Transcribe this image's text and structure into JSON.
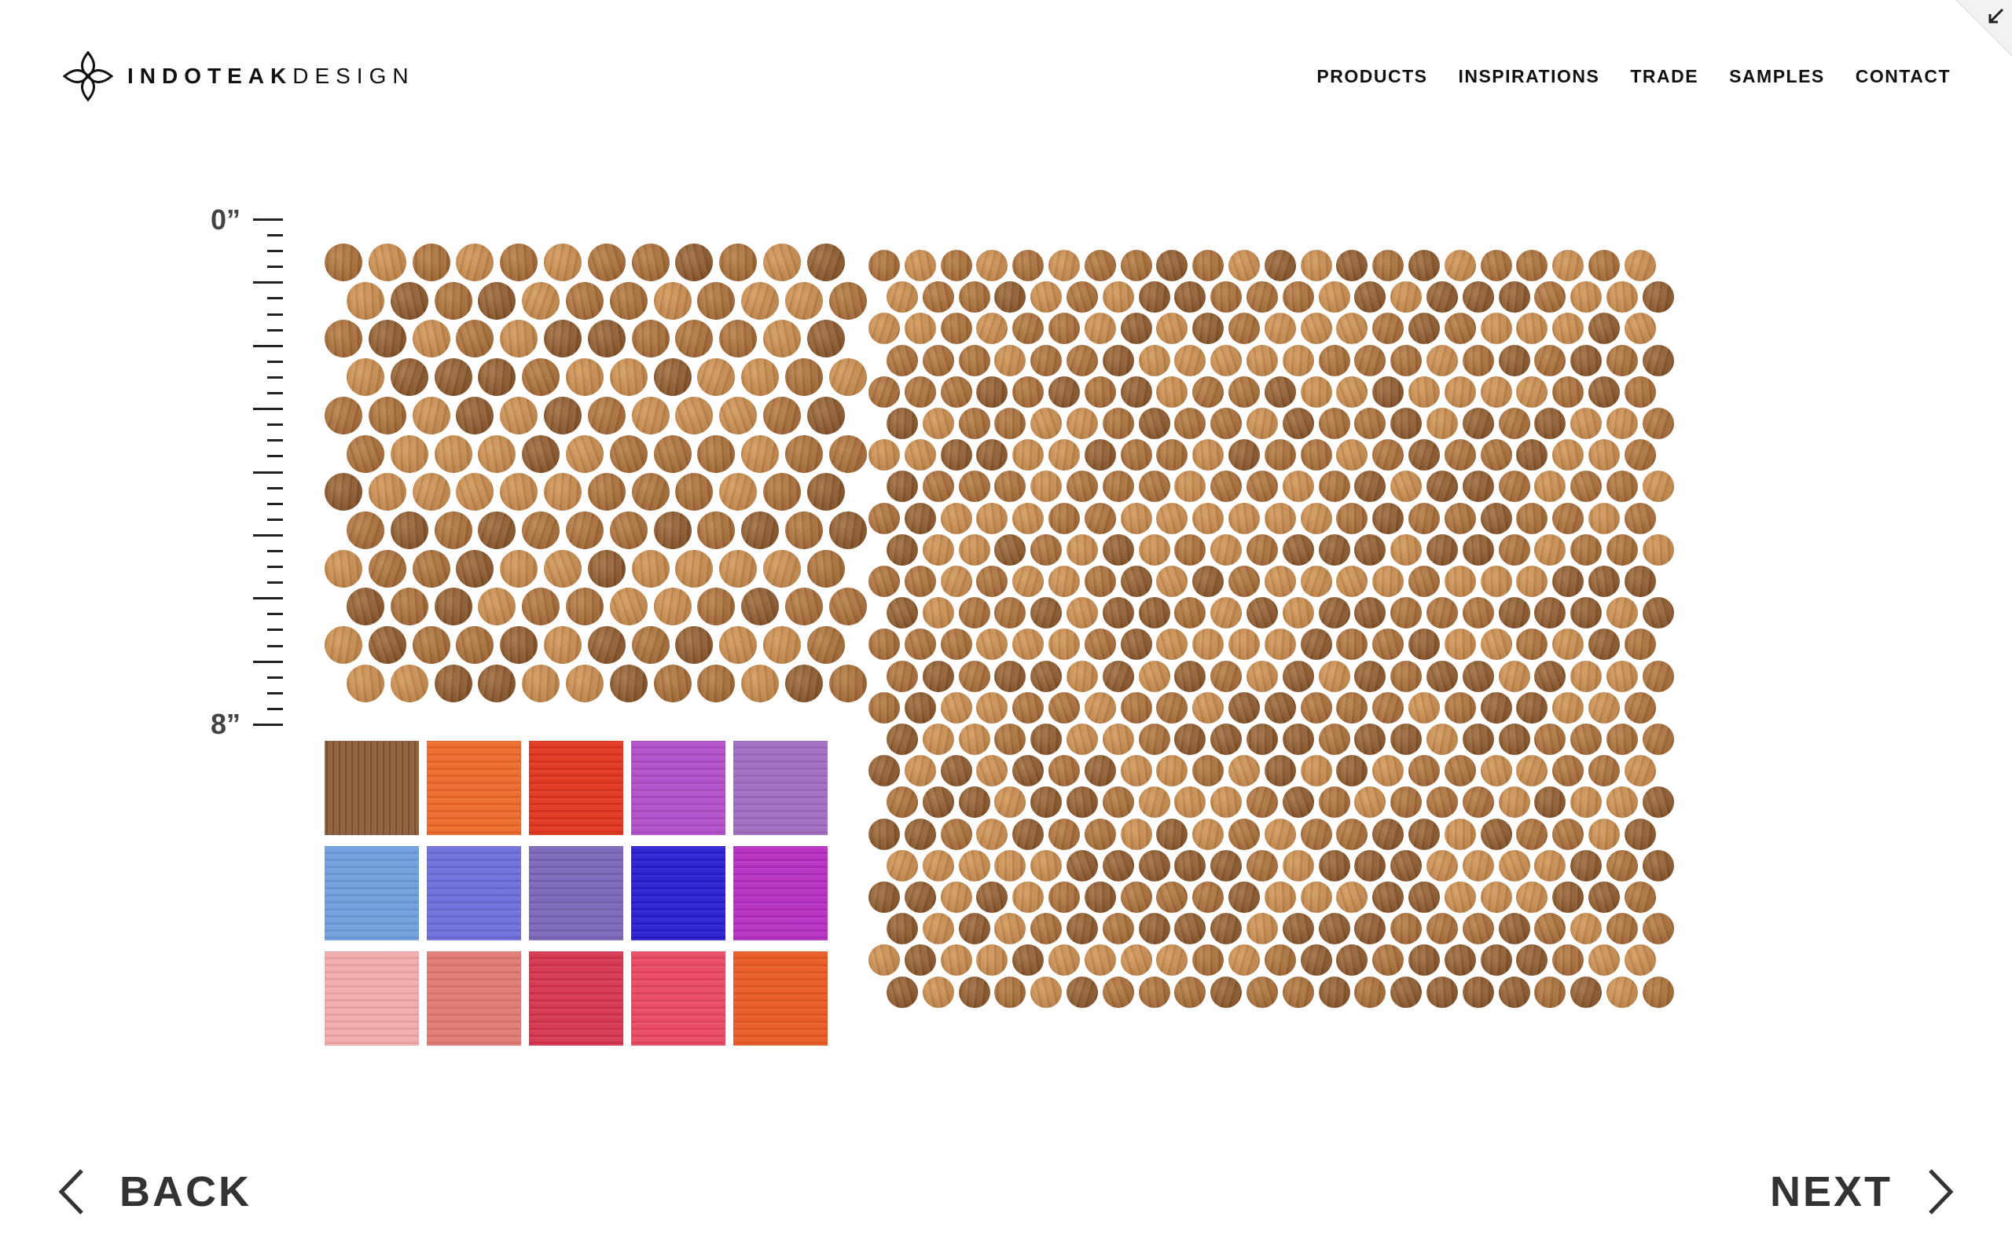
{
  "brand": {
    "name_strong": "INDOTEAK",
    "name_light": "DESIGN",
    "logo_icon": "four-petal-logo-icon"
  },
  "nav": {
    "items": [
      "PRODUCTS",
      "INSPIRATIONS",
      "TRADE",
      "SAMPLES",
      "CONTACT"
    ]
  },
  "ruler": {
    "top_label": "0”",
    "bottom_label": "8”",
    "tick_count": 33
  },
  "colors": {
    "wood_light": "#c98a4b",
    "wood_mid": "#a86a35",
    "wood_dark": "#8a5529",
    "text": "#333333"
  },
  "swatches": [
    {
      "name": "natural-teak",
      "color": "#8a5a38",
      "grain": "vertical"
    },
    {
      "name": "orange",
      "color": "#ee6a2c",
      "grain": "horizontal"
    },
    {
      "name": "red",
      "color": "#e0351e",
      "grain": "horizontal"
    },
    {
      "name": "magenta-violet",
      "color": "#b04ec9",
      "grain": "horizontal"
    },
    {
      "name": "lilac",
      "color": "#a06cc0",
      "grain": "horizontal"
    },
    {
      "name": "sky-blue",
      "color": "#6f9ede",
      "grain": "horizontal"
    },
    {
      "name": "periwinkle",
      "color": "#6d6fd8",
      "grain": "horizontal"
    },
    {
      "name": "lavender",
      "color": "#7b66ba",
      "grain": "horizontal"
    },
    {
      "name": "cobalt",
      "color": "#2a1fd0",
      "grain": "horizontal"
    },
    {
      "name": "fuchsia",
      "color": "#b52ec2",
      "grain": "horizontal"
    },
    {
      "name": "blush-pink",
      "color": "#f2aaaa",
      "grain": "horizontal"
    },
    {
      "name": "coral",
      "color": "#e07a72",
      "grain": "horizontal"
    },
    {
      "name": "crimson",
      "color": "#d6354f",
      "grain": "horizontal"
    },
    {
      "name": "rose-red",
      "color": "#ea4862",
      "grain": "horizontal"
    },
    {
      "name": "tangerine",
      "color": "#e85a22",
      "grain": "horizontal"
    }
  ],
  "sheets": [
    {
      "name": "small-sheet",
      "cols": 12,
      "rows": 12
    },
    {
      "name": "large-sheet",
      "cols": 22,
      "rows": 24
    }
  ],
  "pager": {
    "back_label": "BACK",
    "next_label": "NEXT",
    "back_icon": "chevron-left-icon",
    "next_icon": "chevron-right-icon"
  },
  "corner_icon": "collapse-arrow-icon"
}
